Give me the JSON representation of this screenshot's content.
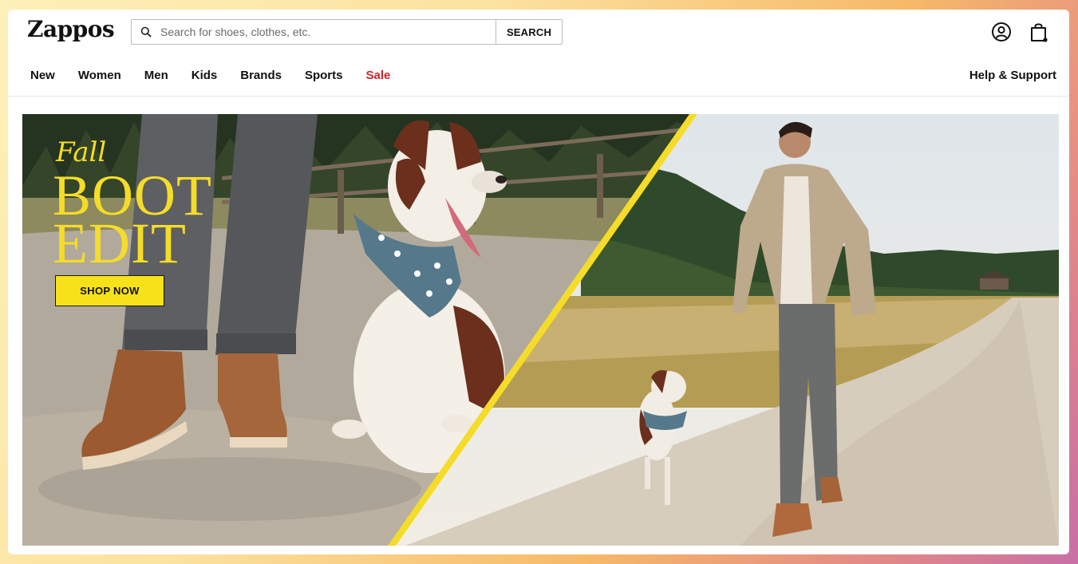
{
  "header": {
    "logo": "Zappos",
    "search": {
      "placeholder": "Search for shoes, clothes, etc.",
      "button_label": "SEARCH"
    },
    "icons": [
      "account-icon",
      "cart-icon"
    ]
  },
  "nav": {
    "items": [
      "New",
      "Women",
      "Men",
      "Kids",
      "Brands",
      "Sports",
      "Sale"
    ],
    "help_label": "Help & Support"
  },
  "hero": {
    "line1": "Fall",
    "line2": "BOOT",
    "line3": "EDIT",
    "cta_label": "SHOP NOW"
  },
  "colors": {
    "accent_yellow": "#f5dc28",
    "sale_red": "#d61f26",
    "text_dark": "#111111"
  }
}
